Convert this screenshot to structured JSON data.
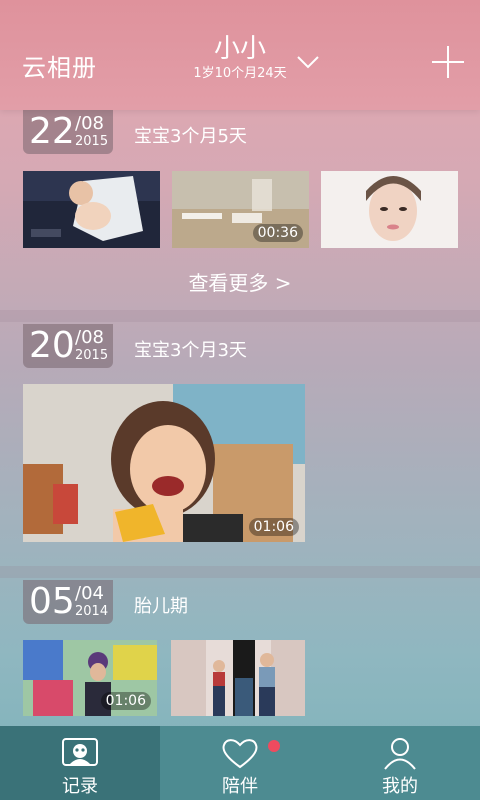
{
  "header": {
    "app_title": "云相册",
    "baby_name": "小小",
    "baby_age": "1岁10个月24天"
  },
  "sections": [
    {
      "day": "22",
      "month": "/08",
      "year": "2015",
      "age_label": "宝宝3个月5天",
      "media": [
        {
          "kind": "photo",
          "subject": "baby-on-blanket"
        },
        {
          "kind": "video",
          "subject": "table-scene",
          "duration": "00:36"
        },
        {
          "kind": "photo",
          "subject": "woman-portrait"
        }
      ],
      "more_label": "查看更多 >"
    },
    {
      "day": "20",
      "month": "/08",
      "year": "2015",
      "age_label": "宝宝3个月3天",
      "media": [
        {
          "kind": "video",
          "subject": "smiling-girl-with-mango",
          "duration": "01:06"
        }
      ]
    },
    {
      "day": "05",
      "month": "/04",
      "year": "2014",
      "age_label": "胎儿期",
      "media": [
        {
          "kind": "video",
          "subject": "child-graffiti-wall",
          "duration": "01:06"
        },
        {
          "kind": "photo",
          "subject": "family-standing"
        }
      ]
    }
  ],
  "tabs": [
    {
      "label": "记录",
      "icon": "record-icon",
      "active": true
    },
    {
      "label": "陪伴",
      "icon": "heart-icon",
      "active": false,
      "notification": true
    },
    {
      "label": "我的",
      "icon": "person-icon",
      "active": false
    }
  ],
  "colors": {
    "header_bg": "#df929c",
    "tabbar_bg": "#4d8b91",
    "tab_active_bg": "#3a7278",
    "notification_dot": "#ef4b5f"
  }
}
